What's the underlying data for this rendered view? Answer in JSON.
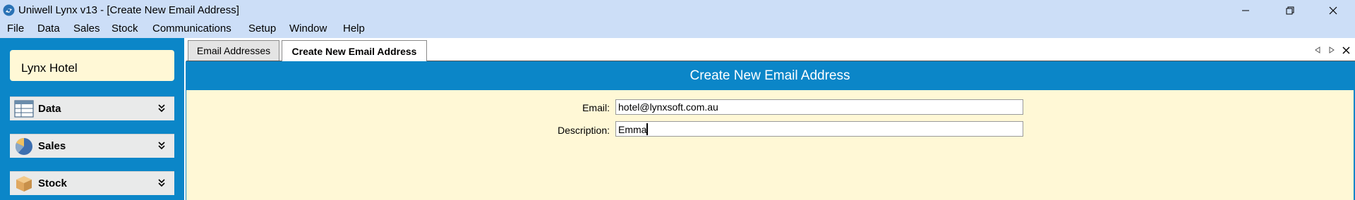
{
  "window": {
    "title": "Uniwell Lynx v13 - [Create New Email Address]",
    "controls": {
      "minimize": "minimize",
      "restore": "restore",
      "close": "close"
    }
  },
  "menu": [
    "File",
    "Data",
    "Sales",
    "Stock",
    "Communications",
    "Setup",
    "Window",
    "Help"
  ],
  "sidebar": {
    "hotel_name": "Lynx Hotel",
    "sections": [
      {
        "label": "Data",
        "icon": "data-table-icon"
      },
      {
        "label": "Sales",
        "icon": "pie-chart-icon"
      },
      {
        "label": "Stock",
        "icon": "box-icon"
      }
    ]
  },
  "tabs": [
    {
      "label": "Email Addresses",
      "active": false
    },
    {
      "label": "Create New Email Address",
      "active": true
    }
  ],
  "content": {
    "title": "Create New Email Address",
    "fields": [
      {
        "label": "Email:",
        "value": "hotel@lynxsoft.com.au"
      },
      {
        "label": "Description:",
        "value": "Emma"
      }
    ]
  },
  "colors": {
    "titlebar": "#ccdef7",
    "accent_blue": "#0b86c8",
    "panel_cream": "#fff8d6",
    "section_gray": "#e9eaea"
  }
}
